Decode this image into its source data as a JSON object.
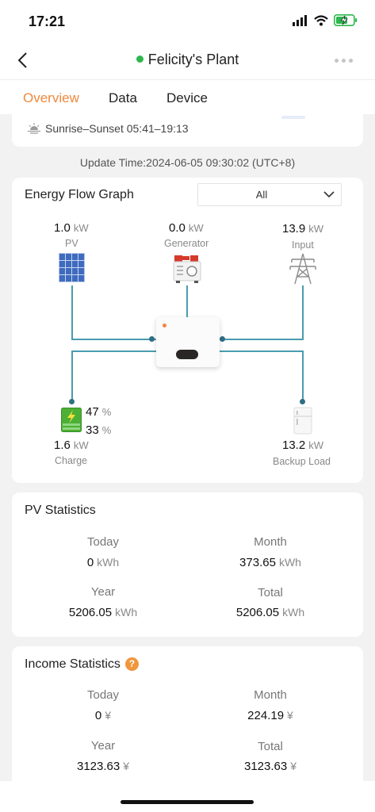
{
  "status": {
    "time": "17:21"
  },
  "nav": {
    "title": "Felicity's Plant"
  },
  "tabs": [
    {
      "label": "Overview"
    },
    {
      "label": "Data"
    },
    {
      "label": "Device"
    }
  ],
  "sun": {
    "text": "Sunrise–Sunset 05:41–19:13"
  },
  "update_time": "Update Time:2024-06-05 09:30:02 (UTC+8)",
  "energy_flow": {
    "title": "Energy Flow Graph",
    "filter": {
      "selected": "All"
    },
    "pv": {
      "value": "1.0",
      "unit": "kW",
      "label": "PV"
    },
    "generator": {
      "value": "0.0",
      "unit": "kW",
      "label": "Generator"
    },
    "input": {
      "value": "13.9",
      "unit": "kW",
      "label": "Input"
    },
    "battery": {
      "percent1": "47",
      "percent2": "33",
      "pct_unit": "%",
      "value": "1.6",
      "unit": "kW",
      "label": "Charge"
    },
    "backup": {
      "value": "13.2",
      "unit": "kW",
      "label": "Backup Load"
    }
  },
  "pv_stats": {
    "title": "PV Statistics",
    "today": {
      "label": "Today",
      "value": "0",
      "unit": "kWh"
    },
    "month": {
      "label": "Month",
      "value": "373.65",
      "unit": "kWh"
    },
    "year": {
      "label": "Year",
      "value": "5206.05",
      "unit": "kWh"
    },
    "total": {
      "label": "Total",
      "value": "5206.05",
      "unit": "kWh"
    }
  },
  "income_stats": {
    "title": "Income Statistics",
    "help": "?",
    "today": {
      "label": "Today",
      "value": "0",
      "unit": "¥"
    },
    "month": {
      "label": "Month",
      "value": "224.19",
      "unit": "¥"
    },
    "year": {
      "label": "Year",
      "value": "3123.63",
      "unit": "¥"
    },
    "total": {
      "label": "Total",
      "value": "3123.63",
      "unit": "¥"
    }
  }
}
